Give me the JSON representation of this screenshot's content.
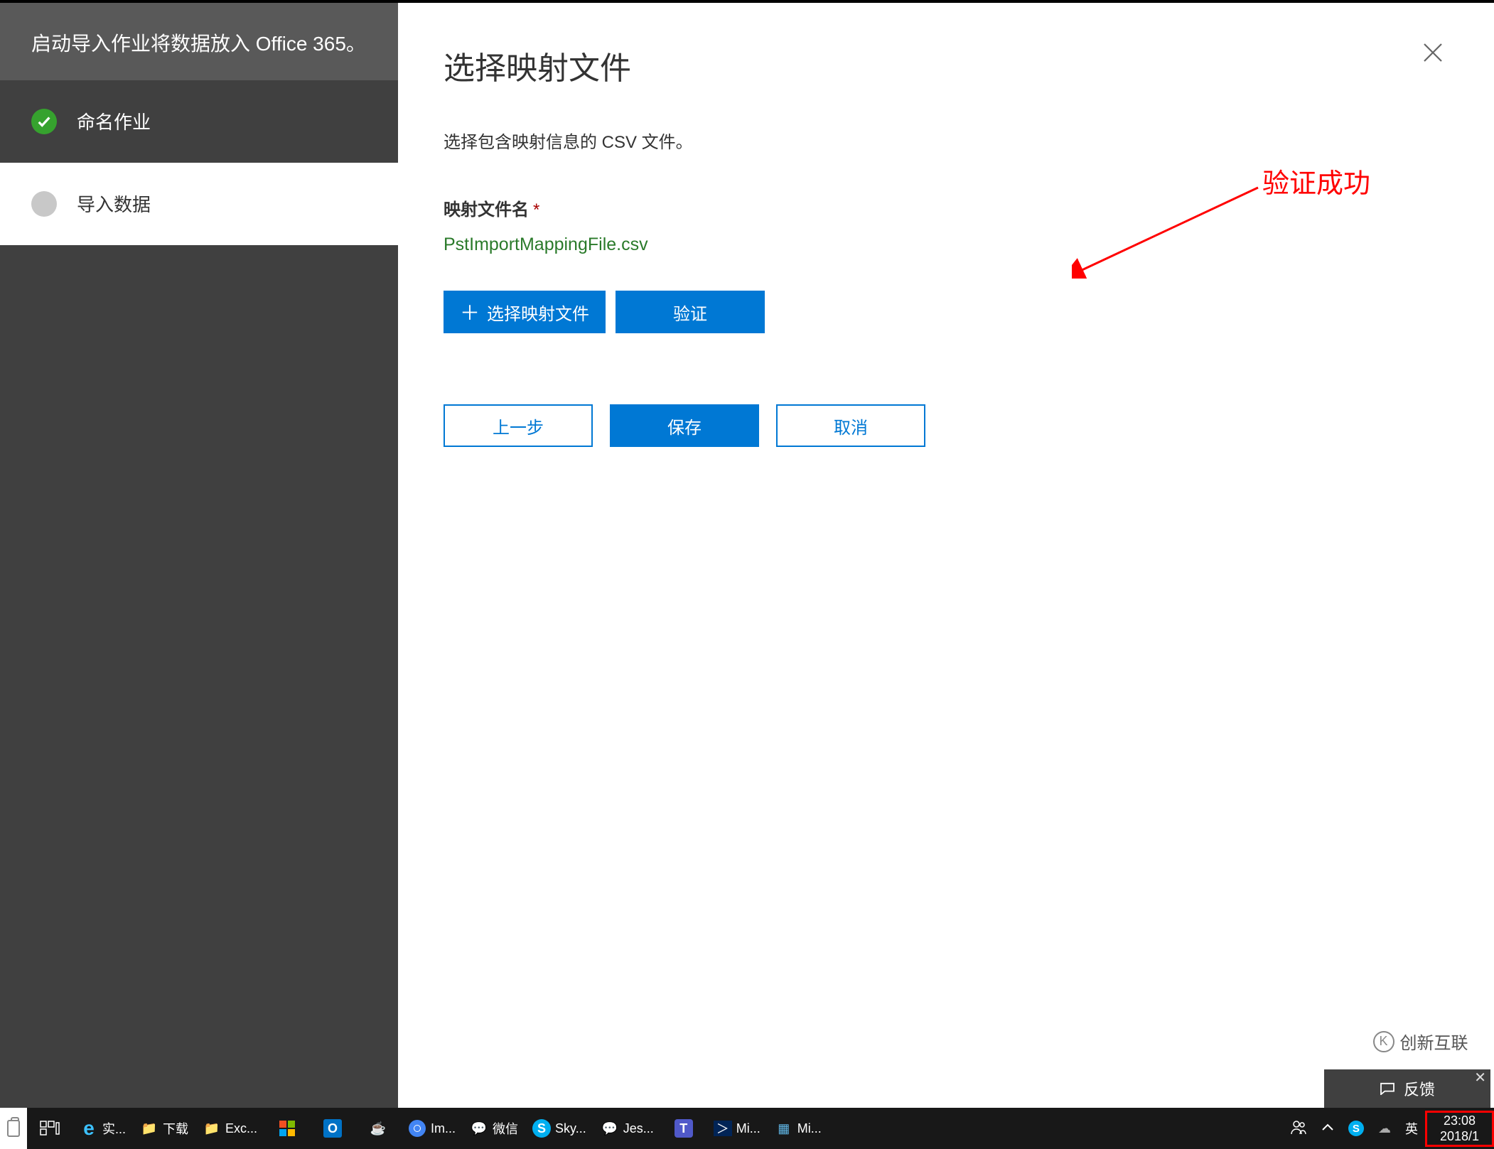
{
  "sidebar": {
    "header": "启动导入作业将数据放入 Office 365。",
    "steps": [
      {
        "label": "命名作业",
        "state": "done"
      },
      {
        "label": "导入数据",
        "state": "pending"
      }
    ]
  },
  "main": {
    "title": "选择映射文件",
    "subtitle": "选择包含映射信息的 CSV 文件。",
    "field_label": "映射文件名",
    "required_mark": "*",
    "selected_file": "PstImportMappingFile.csv",
    "buttons": {
      "select_file": "选择映射文件",
      "validate": "验证",
      "back": "上一步",
      "save": "保存",
      "cancel": "取消"
    }
  },
  "annotation": {
    "text": "验证成功"
  },
  "feedback": {
    "label": "反馈",
    "close": "✕"
  },
  "taskbar": {
    "items": [
      {
        "icon": "taskview",
        "label": ""
      },
      {
        "icon": "edge",
        "label": "实..."
      },
      {
        "icon": "folder-dl",
        "label": "下载"
      },
      {
        "icon": "folder",
        "label": "Exc..."
      },
      {
        "icon": "store",
        "label": ""
      },
      {
        "icon": "outlook",
        "label": ""
      },
      {
        "icon": "java",
        "label": ""
      },
      {
        "icon": "chrome",
        "label": "Im..."
      },
      {
        "icon": "wechat",
        "label": "微信"
      },
      {
        "icon": "skype",
        "label": "Sky..."
      },
      {
        "icon": "chat",
        "label": "Jes..."
      },
      {
        "icon": "teams",
        "label": ""
      },
      {
        "icon": "powershell",
        "label": "Mi..."
      },
      {
        "icon": "server",
        "label": "Mi..."
      }
    ],
    "tray": {
      "ime": "英",
      "time": "23:08",
      "date": "2018/1"
    }
  },
  "watermark": "创新互联"
}
